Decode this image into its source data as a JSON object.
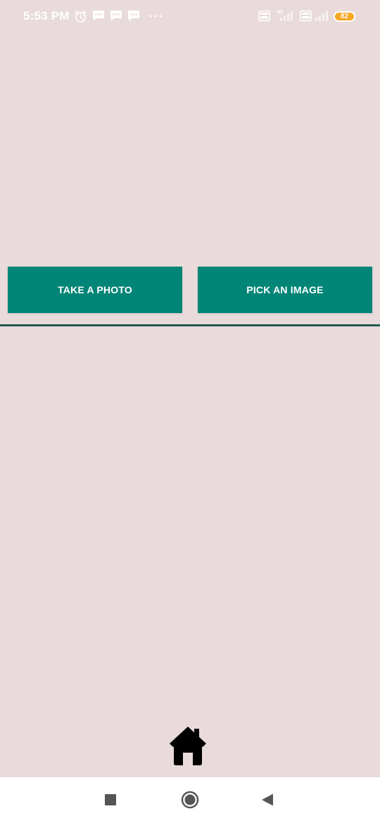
{
  "status_bar": {
    "time": "5:53 PM",
    "network_label": "4G",
    "battery": "82",
    "icons": [
      "alarm-icon",
      "message-icon",
      "message-icon",
      "message-icon",
      "more-dots-icon",
      "volte-icon",
      "signal-icon",
      "volte-icon",
      "signal-icon",
      "battery-icon"
    ]
  },
  "buttons": {
    "take_photo": "TAKE A PHOTO",
    "pick_image": "PICK AN IMAGE"
  },
  "bottom": {
    "home_icon": "home-icon"
  },
  "nav_bar": {
    "icons": [
      "recent-apps-icon",
      "home-circle-icon",
      "back-icon"
    ]
  },
  "colors": {
    "background": "#E9DBDB",
    "button": "#008577",
    "button_text": "#FFFFFF",
    "divider": "#21594F",
    "battery": "#F5A623",
    "nav_bar": "#FFFFFF"
  }
}
